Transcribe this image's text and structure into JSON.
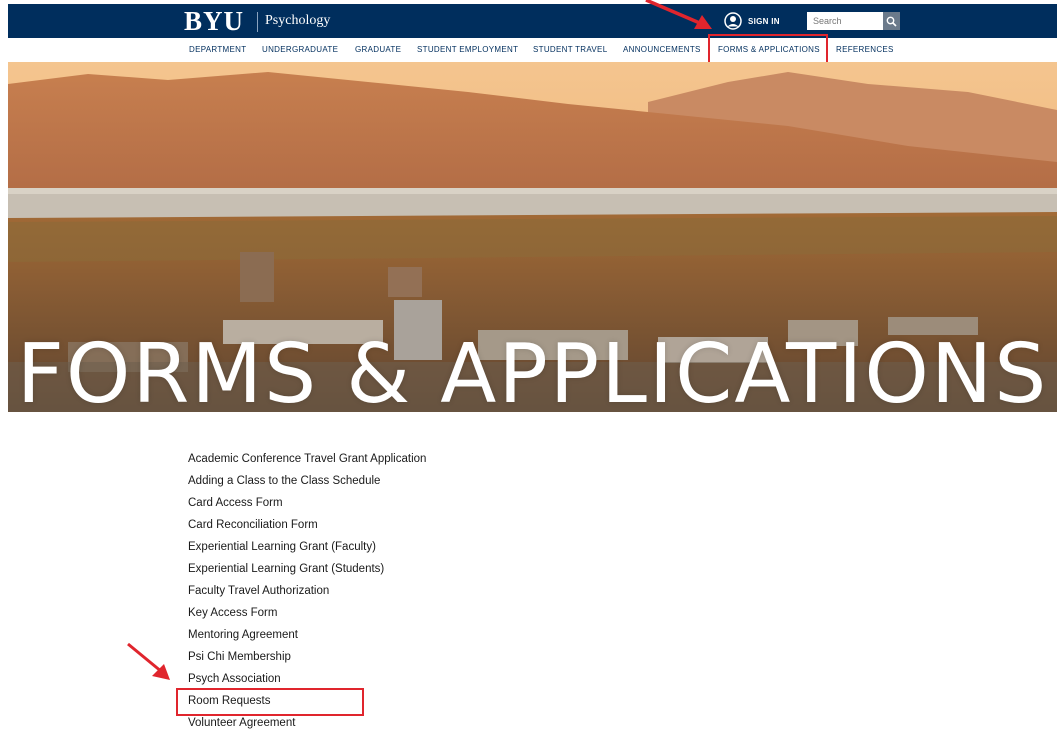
{
  "header": {
    "logo": "BYU",
    "department": "Psychology",
    "sign_in_label": "SIGN IN",
    "search_placeholder": "Search",
    "user_icon": "user-circle-icon",
    "search_icon": "magnifier-icon"
  },
  "nav": {
    "items": [
      "DEPARTMENT",
      "UNDERGRADUATE",
      "GRADUATE",
      "STUDENT EMPLOYMENT",
      "STUDENT TRAVEL",
      "ANNOUNCEMENTS",
      "FORMS & APPLICATIONS",
      "REFERENCES"
    ]
  },
  "hero": {
    "title": "FORMS & APPLICATIONS"
  },
  "forms": [
    "Academic Conference Travel Grant Application",
    "Adding a Class to the Class Schedule",
    "Card Access Form",
    "Card Reconciliation Form",
    "Experiential Learning Grant (Faculty)",
    "Experiential Learning Grant (Students)",
    "Faculty Travel Authorization",
    "Key Access Form",
    "Mentoring Agreement",
    "Psi Chi Membership",
    "Psych Association",
    "Room Requests",
    "Volunteer Agreement"
  ],
  "colors": {
    "brand_navy": "#002e5d",
    "annotation_red": "#e0252d"
  }
}
